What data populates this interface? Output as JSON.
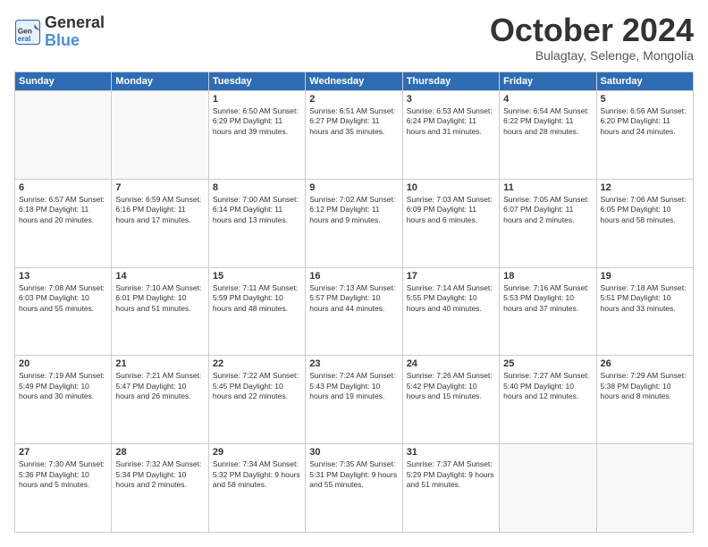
{
  "header": {
    "logo_line1": "General",
    "logo_line2": "Blue",
    "month": "October 2024",
    "location": "Bulagtay, Selenge, Mongolia"
  },
  "weekdays": [
    "Sunday",
    "Monday",
    "Tuesday",
    "Wednesday",
    "Thursday",
    "Friday",
    "Saturday"
  ],
  "weeks": [
    [
      {
        "day": "",
        "info": ""
      },
      {
        "day": "",
        "info": ""
      },
      {
        "day": "1",
        "info": "Sunrise: 6:50 AM\nSunset: 6:29 PM\nDaylight: 11 hours and 39 minutes."
      },
      {
        "day": "2",
        "info": "Sunrise: 6:51 AM\nSunset: 6:27 PM\nDaylight: 11 hours and 35 minutes."
      },
      {
        "day": "3",
        "info": "Sunrise: 6:53 AM\nSunset: 6:24 PM\nDaylight: 11 hours and 31 minutes."
      },
      {
        "day": "4",
        "info": "Sunrise: 6:54 AM\nSunset: 6:22 PM\nDaylight: 11 hours and 28 minutes."
      },
      {
        "day": "5",
        "info": "Sunrise: 6:56 AM\nSunset: 6:20 PM\nDaylight: 11 hours and 24 minutes."
      }
    ],
    [
      {
        "day": "6",
        "info": "Sunrise: 6:57 AM\nSunset: 6:18 PM\nDaylight: 11 hours and 20 minutes."
      },
      {
        "day": "7",
        "info": "Sunrise: 6:59 AM\nSunset: 6:16 PM\nDaylight: 11 hours and 17 minutes."
      },
      {
        "day": "8",
        "info": "Sunrise: 7:00 AM\nSunset: 6:14 PM\nDaylight: 11 hours and 13 minutes."
      },
      {
        "day": "9",
        "info": "Sunrise: 7:02 AM\nSunset: 6:12 PM\nDaylight: 11 hours and 9 minutes."
      },
      {
        "day": "10",
        "info": "Sunrise: 7:03 AM\nSunset: 6:09 PM\nDaylight: 11 hours and 6 minutes."
      },
      {
        "day": "11",
        "info": "Sunrise: 7:05 AM\nSunset: 6:07 PM\nDaylight: 11 hours and 2 minutes."
      },
      {
        "day": "12",
        "info": "Sunrise: 7:06 AM\nSunset: 6:05 PM\nDaylight: 10 hours and 58 minutes."
      }
    ],
    [
      {
        "day": "13",
        "info": "Sunrise: 7:08 AM\nSunset: 6:03 PM\nDaylight: 10 hours and 55 minutes."
      },
      {
        "day": "14",
        "info": "Sunrise: 7:10 AM\nSunset: 6:01 PM\nDaylight: 10 hours and 51 minutes."
      },
      {
        "day": "15",
        "info": "Sunrise: 7:11 AM\nSunset: 5:59 PM\nDaylight: 10 hours and 48 minutes."
      },
      {
        "day": "16",
        "info": "Sunrise: 7:13 AM\nSunset: 5:57 PM\nDaylight: 10 hours and 44 minutes."
      },
      {
        "day": "17",
        "info": "Sunrise: 7:14 AM\nSunset: 5:55 PM\nDaylight: 10 hours and 40 minutes."
      },
      {
        "day": "18",
        "info": "Sunrise: 7:16 AM\nSunset: 5:53 PM\nDaylight: 10 hours and 37 minutes."
      },
      {
        "day": "19",
        "info": "Sunrise: 7:18 AM\nSunset: 5:51 PM\nDaylight: 10 hours and 33 minutes."
      }
    ],
    [
      {
        "day": "20",
        "info": "Sunrise: 7:19 AM\nSunset: 5:49 PM\nDaylight: 10 hours and 30 minutes."
      },
      {
        "day": "21",
        "info": "Sunrise: 7:21 AM\nSunset: 5:47 PM\nDaylight: 10 hours and 26 minutes."
      },
      {
        "day": "22",
        "info": "Sunrise: 7:22 AM\nSunset: 5:45 PM\nDaylight: 10 hours and 22 minutes."
      },
      {
        "day": "23",
        "info": "Sunrise: 7:24 AM\nSunset: 5:43 PM\nDaylight: 10 hours and 19 minutes."
      },
      {
        "day": "24",
        "info": "Sunrise: 7:26 AM\nSunset: 5:42 PM\nDaylight: 10 hours and 15 minutes."
      },
      {
        "day": "25",
        "info": "Sunrise: 7:27 AM\nSunset: 5:40 PM\nDaylight: 10 hours and 12 minutes."
      },
      {
        "day": "26",
        "info": "Sunrise: 7:29 AM\nSunset: 5:38 PM\nDaylight: 10 hours and 8 minutes."
      }
    ],
    [
      {
        "day": "27",
        "info": "Sunrise: 7:30 AM\nSunset: 5:36 PM\nDaylight: 10 hours and 5 minutes."
      },
      {
        "day": "28",
        "info": "Sunrise: 7:32 AM\nSunset: 5:34 PM\nDaylight: 10 hours and 2 minutes."
      },
      {
        "day": "29",
        "info": "Sunrise: 7:34 AM\nSunset: 5:32 PM\nDaylight: 9 hours and 58 minutes."
      },
      {
        "day": "30",
        "info": "Sunrise: 7:35 AM\nSunset: 5:31 PM\nDaylight: 9 hours and 55 minutes."
      },
      {
        "day": "31",
        "info": "Sunrise: 7:37 AM\nSunset: 5:29 PM\nDaylight: 9 hours and 51 minutes."
      },
      {
        "day": "",
        "info": ""
      },
      {
        "day": "",
        "info": ""
      }
    ]
  ]
}
